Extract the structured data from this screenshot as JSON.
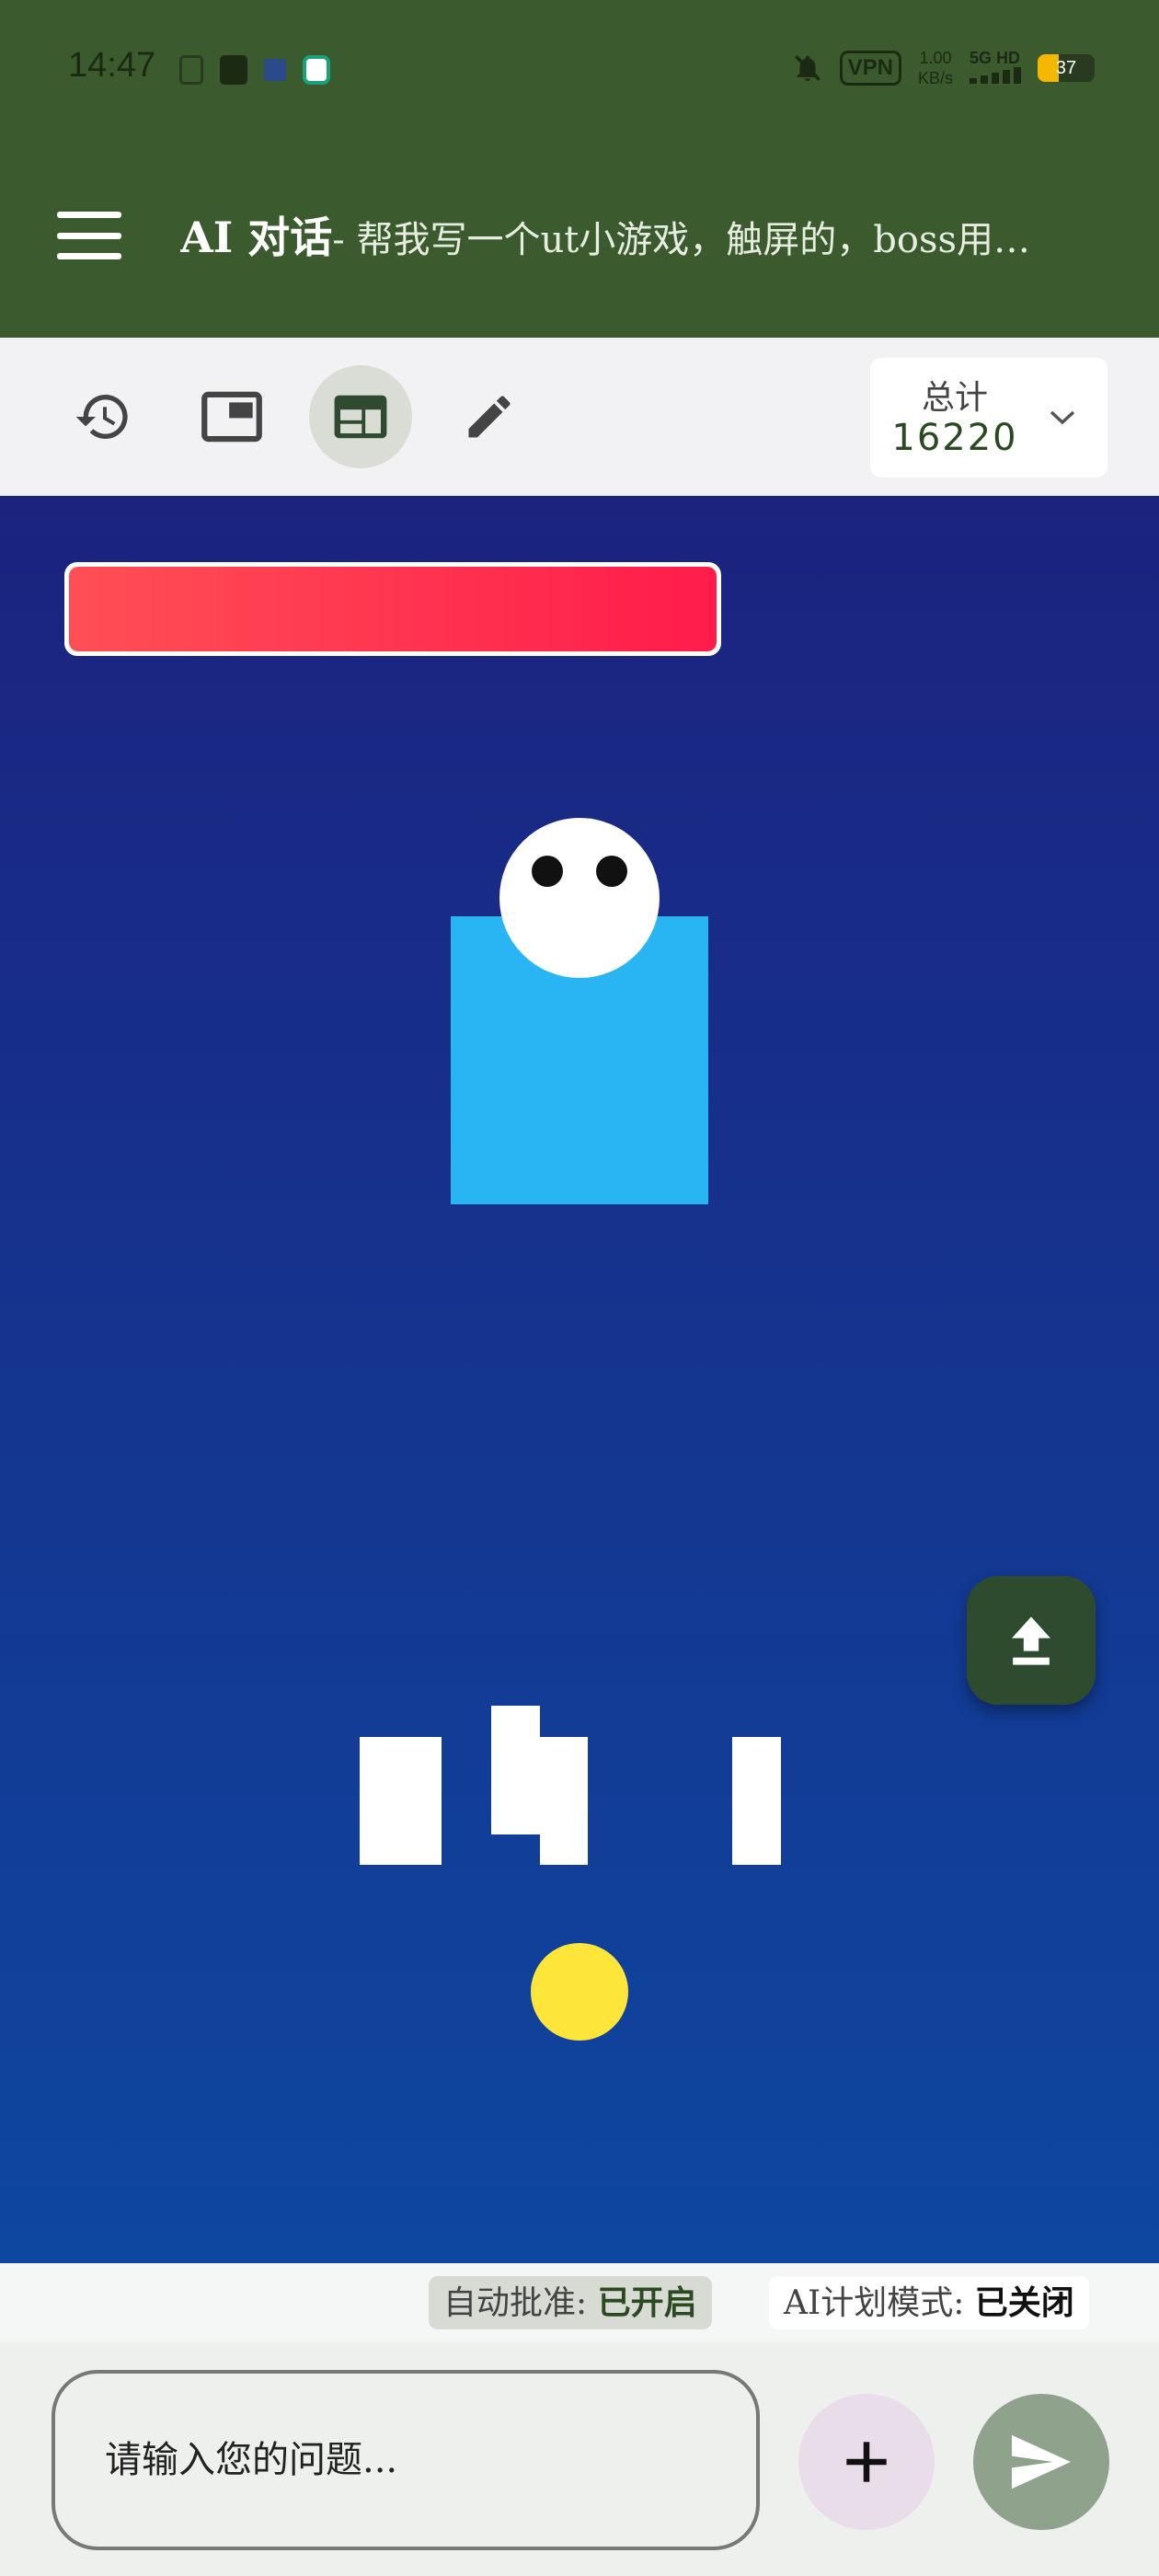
{
  "status_bar": {
    "time": "14:47",
    "vpn": "VPN",
    "speed_value": "1.00",
    "speed_unit": "KB/s",
    "network": "5G HD",
    "battery_level": "37",
    "battery_fraction": 0.37,
    "icons": [
      "file-icon",
      "sim-card-icon",
      "app-icon",
      "bank-app-icon",
      "mute-bell-icon",
      "signal-icon",
      "battery-icon"
    ]
  },
  "app_bar": {
    "title": "AI 对话",
    "subtitle": "- 帮我写一个ut小游戏，触屏的，boss用…",
    "menu_icon": "hamburger-menu-icon"
  },
  "toolbar": {
    "buttons": [
      "history-icon",
      "picture-in-picture-icon",
      "web-layout-icon",
      "edit-pencil-icon"
    ],
    "active_button": "web-layout-icon",
    "total_label": "总计",
    "total_value": "16220"
  },
  "game": {
    "boss_hp_fraction": 1.0,
    "colors": {
      "background_top": "#1b237f",
      "background_bottom": "#0e47a0",
      "boss_body": "#29b5f4",
      "player": "#fde53a",
      "health_bar": "#ff1c4b"
    }
  },
  "mode_strip": {
    "auto_approve_label": "自动批准: ",
    "auto_approve_value": "已开启",
    "plan_mode_label": "AI计划模式: ",
    "plan_mode_value": "已关闭"
  },
  "input": {
    "placeholder": "请输入您的问题..."
  },
  "colors": {
    "app_bar": "#3b5a2e",
    "accent_dark_green": "#2e4a2f",
    "send_button": "#8fa38c",
    "add_button": "#e8dde8"
  }
}
